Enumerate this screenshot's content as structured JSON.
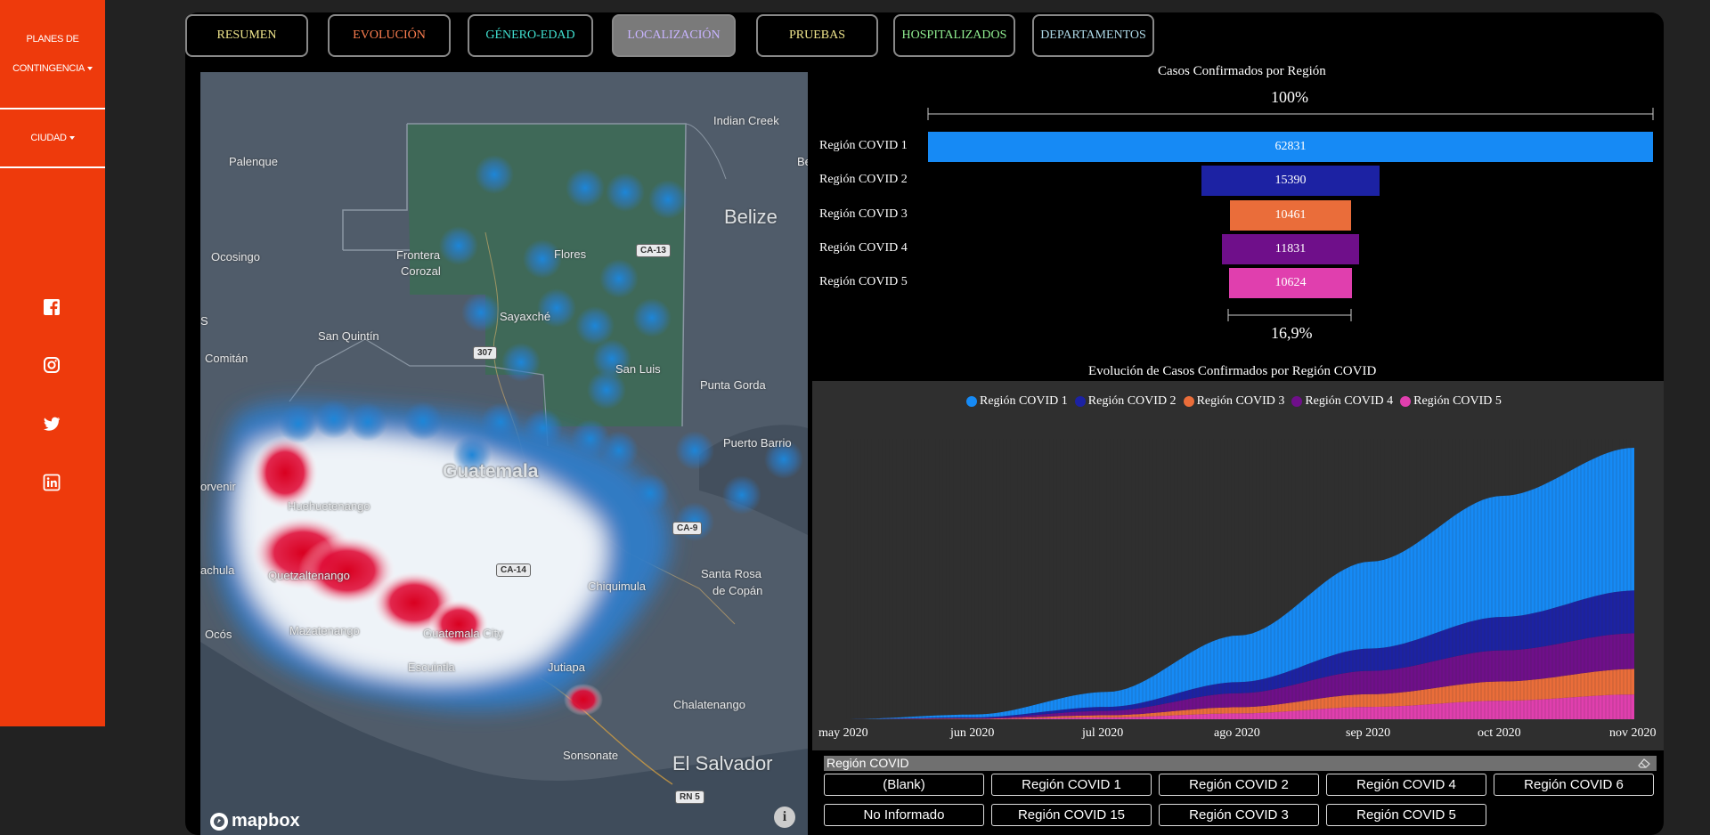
{
  "sidebar": {
    "planes_line1": "PLANES DE",
    "planes_line2": "CONTINGENCIA",
    "ciudad": "CIUDAD",
    "social": [
      "facebook-icon",
      "instagram-icon",
      "twitter-icon",
      "linkedin-icon"
    ],
    "bg_color": "#ee3a0c"
  },
  "tabs": [
    {
      "label": "RESUMEN",
      "color": "#f0e68c"
    },
    {
      "label": "EVOLUCIÓN",
      "color": "#ff7f50"
    },
    {
      "label": "GÉNERO-EDAD",
      "color": "#40e0d0"
    },
    {
      "label": "LOCALIZACIÓN",
      "color": "#c8b4ff",
      "active": true
    },
    {
      "label": "PRUEBAS",
      "color": "#f0e68c"
    },
    {
      "label": "HOSPITALIZADOS",
      "color": "#90ee90"
    },
    {
      "label": "DEPARTAMENTOS",
      "color": "#add8e6"
    }
  ],
  "map": {
    "labels": {
      "indian_creek": "Indian Creek",
      "belize": "Belize",
      "palenque": "Palenque",
      "ocosingo": "Ocosingo",
      "frontera": "Frontera",
      "corozal": "Corozal",
      "flores": "Flores",
      "sayaxche": "Sayaxché",
      "san_quintin": "San Quintín",
      "comitan": "Comitán",
      "san_luis": "San Luis",
      "punta_gorda": "Punta Gorda",
      "puerto_barrios": "Puerto Barrio",
      "guatemala": "Guatemala",
      "huehuetenango": "Huehuetenango",
      "quetzaltenango": "Quetzaltenango",
      "mazatenango": "Mazatenango",
      "guatemala_city": "Guatemala City",
      "escuintla": "Escuintla",
      "jutiapa": "Jutiapa",
      "chiquimula": "Chiquimula",
      "santa_rosa": "Santa Rosa",
      "de_copan": "de Copán",
      "chalatenango": "Chalatenango",
      "sonsonate": "Sonsonate",
      "el_salvador": "El Salvador",
      "ocos": "Ocós",
      "s": "S",
      "orvenir": "orvenir",
      "achula": "achula",
      "be": "Be"
    },
    "roads": {
      "ca13": "CA-13",
      "r307": "307",
      "ca9": "CA-9",
      "ca14": "CA-14",
      "rn5": "RN 5"
    },
    "logo": "mapbox"
  },
  "bar_title": "Casos Confirmados por Región",
  "bar_top_pct": "100%",
  "bar_bottom_pct": "16,9%",
  "area_title": "Evolución de Casos Confirmados por Región COVID",
  "chart_data": [
    {
      "type": "bar",
      "title": "Casos Confirmados por Región",
      "categories": [
        "Región COVID 1",
        "Región COVID 2",
        "Región COVID 3",
        "Región COVID 4",
        "Región COVID 5"
      ],
      "values": [
        62831,
        15390,
        10461,
        11831,
        10624
      ],
      "colors": [
        "#168af5",
        "#1c22a3",
        "#ea6d3a",
        "#6f0f8a",
        "#e03fae"
      ],
      "annotations": [
        "100%",
        "16,9%"
      ]
    },
    {
      "type": "area",
      "title": "Evolución de Casos Confirmados por Región COVID",
      "x": [
        "may 2020",
        "jun 2020",
        "jul 2020",
        "ago 2020",
        "sep 2020",
        "oct 2020",
        "nov 2020"
      ],
      "series": [
        {
          "name": "Región COVID 1",
          "color": "#168af5",
          "values": [
            0,
            900,
            4800,
            15000,
            28000,
            39000,
            46000
          ]
        },
        {
          "name": "Región COVID 2",
          "color": "#1c22a3",
          "values": [
            0,
            250,
            1300,
            3600,
            7200,
            10800,
            13800
          ]
        },
        {
          "name": "Región COVID 3",
          "color": "#ea6d3a",
          "values": [
            0,
            120,
            700,
            2000,
            4100,
            6200,
            8200
          ]
        },
        {
          "name": "Región COVID 4",
          "color": "#6f0f8a",
          "values": [
            0,
            180,
            1400,
            4500,
            7500,
            10000,
            11500
          ]
        },
        {
          "name": "Región COVID 5",
          "color": "#e03fae",
          "values": [
            0,
            90,
            600,
            1900,
            4000,
            6000,
            8000
          ]
        }
      ]
    }
  ],
  "filter": {
    "header": "Región COVID",
    "options": [
      "(Blank)",
      "Región COVID 1",
      "Región COVID 2",
      "Región COVID 4",
      "Región COVID 6",
      "No Informado",
      "Región COVID 15",
      "Región COVID 3",
      "Región COVID 5"
    ]
  }
}
